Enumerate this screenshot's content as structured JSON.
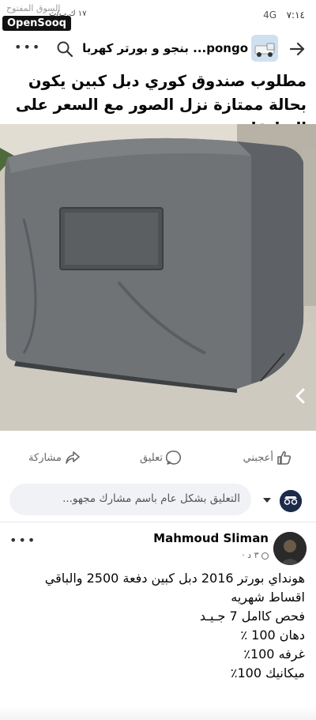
{
  "status": {
    "time": "٧:١٤",
    "network": "4G",
    "right_icons": "١٧ ك.ب/ث"
  },
  "watermark": {
    "arabic": "السوق المفتوح",
    "brand": "OpenSooq"
  },
  "header": {
    "title": "pongo... بنجو و بورتر كهربا"
  },
  "post": {
    "text": "مطلوب صندوق كوري دبل كبين يكون بحالة ممتازة نزل الصور مع السعر على التعليقات",
    "actions": {
      "like": "أعجبني",
      "comment": "تعليق",
      "share": "مشاركة"
    },
    "comment_placeholder": "التعليق بشكل عام باسم مشارك مجهو..."
  },
  "second_post": {
    "author": "Mahmoud Sliman",
    "meta": "٣ د ·",
    "body": "هونداي بورتر 2016 دبل كبين دفعة 2500 والباقي اقساط شهريه\nفحص كاامل 7 جـيـد\nدهان 100 ٪\nغرفه 100٪\nميكانيك 100٪"
  }
}
